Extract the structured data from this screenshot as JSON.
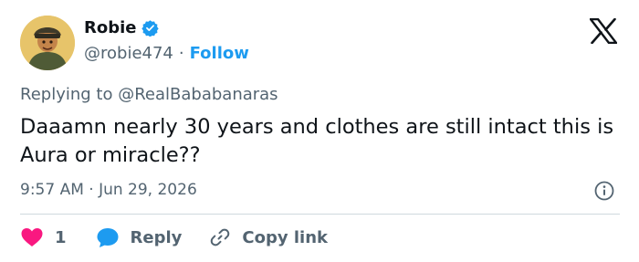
{
  "author": {
    "display_name": "Robie",
    "handle": "@robie474",
    "separator": "·",
    "follow_label": "Follow"
  },
  "reply_context": {
    "prefix": "Replying to",
    "mention": "@RealBababanaras"
  },
  "tweet": {
    "text": "Daaamn nearly 30 years and clothes are still intact this is Aura or miracle??",
    "timestamp": "9:57 AM · Jun 29, 2026"
  },
  "actions": {
    "like_count": "1",
    "reply_label": "Reply",
    "copy_link_label": "Copy link"
  },
  "icons": {
    "verified": "verified-badge-icon",
    "brand": "x-logo-icon",
    "info": "info-icon",
    "like": "heart-icon",
    "reply": "chat-bubble-icon",
    "copy": "link-icon"
  },
  "colors": {
    "accent": "#1d9bf0",
    "like": "#f91880",
    "text": "#0f1419",
    "muted": "#536471",
    "divider": "#cfd9de"
  }
}
